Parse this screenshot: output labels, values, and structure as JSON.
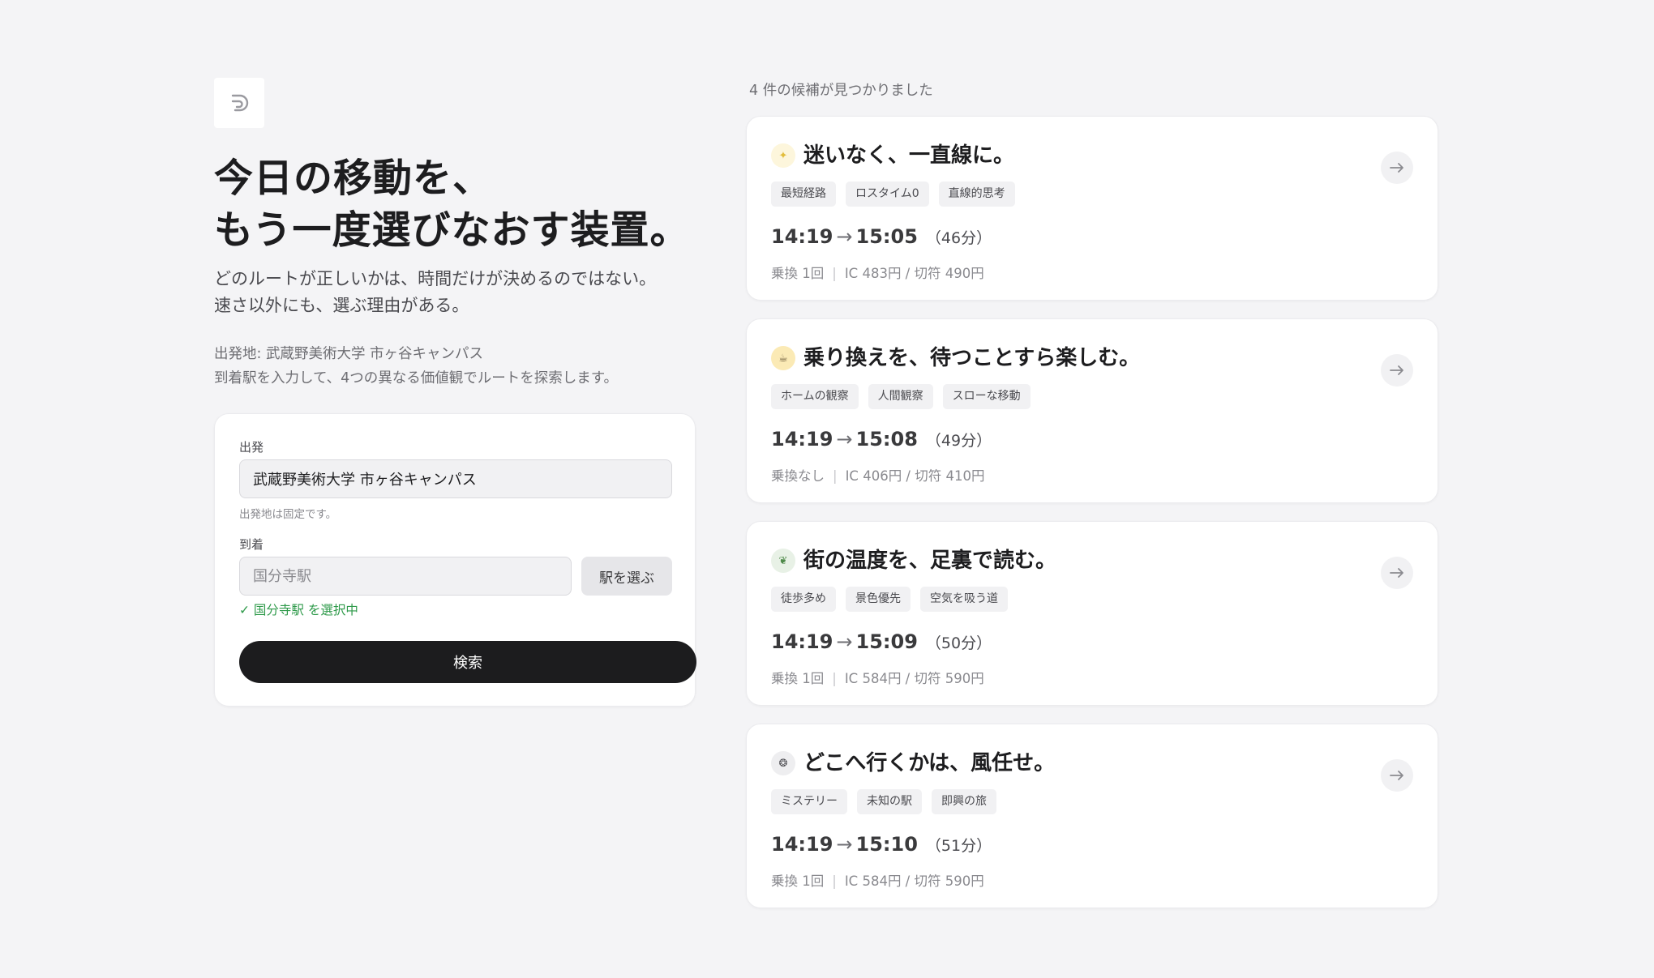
{
  "intro": {
    "headline_line1": "今日の移動を、",
    "headline_line2": "もう一度選びなおす装置。",
    "lead_line1": "どのルートが正しいかは、時間だけが決めるのではない。",
    "lead_line2": "速さ以外にも、選ぶ理由がある。",
    "origin_text": "出発地: 武蔵野美術大学 市ヶ谷キャンパス",
    "instruction": "到着駅を入力して、4つの異なる価値観でルートを探索します。"
  },
  "form": {
    "departure_label": "出発",
    "departure_value": "武蔵野美術大学 市ヶ谷キャンパス",
    "departure_hint": "出発地は固定です。",
    "arrival_label": "到着",
    "arrival_value": "",
    "arrival_placeholder": "国分寺駅",
    "pick_station_label": "駅を選ぶ",
    "selected_text": "✓ 国分寺駅 を選択中",
    "search_label": "検索"
  },
  "results": {
    "count_text": "4 件の候補が見つかりました",
    "routes": [
      {
        "icon": "sparkle-icon",
        "badge_glyph": "✦",
        "badge_color": "#fdf6dc",
        "glyph_color": "#e2bd3c",
        "title": "迷いなく、一直線に。",
        "tags": [
          "最短経路",
          "ロスタイム0",
          "直線的思考"
        ],
        "depart": "14:19",
        "arrow": "→",
        "arrive": "15:05",
        "duration": "（46分）",
        "transfer": "乗換 1回",
        "fare": "IC 483円 / 切符 490円"
      },
      {
        "icon": "coffee-cup-icon",
        "badge_glyph": "☕",
        "badge_color": "#fbeab5",
        "glyph_color": "#6b5a3a",
        "title": "乗り換えを、待つことすら楽しむ。",
        "tags": [
          "ホームの観察",
          "人間観察",
          "スローな移動"
        ],
        "depart": "14:19",
        "arrow": "→",
        "arrive": "15:08",
        "duration": "（49分）",
        "transfer": "乗換なし",
        "fare": "IC 406円 / 切符 410円"
      },
      {
        "icon": "leaf-icon",
        "badge_glyph": "❦",
        "badge_color": "#e8f1e6",
        "glyph_color": "#4f8a4a",
        "title": "街の温度を、足裏で読む。",
        "tags": [
          "徒歩多め",
          "景色優先",
          "空気を吸う道"
        ],
        "depart": "14:19",
        "arrow": "→",
        "arrive": "15:09",
        "duration": "（50分）",
        "transfer": "乗換 1回",
        "fare": "IC 584円 / 切符 590円"
      },
      {
        "icon": "wind-chime-icon",
        "badge_glyph": "❂",
        "badge_color": "#eeeef0",
        "glyph_color": "#4a4a4f",
        "title": "どこへ行くかは、風任せ。",
        "tags": [
          "ミステリー",
          "未知の駅",
          "即興の旅"
        ],
        "depart": "14:19",
        "arrow": "→",
        "arrive": "15:10",
        "duration": "（51分）",
        "transfer": "乗換 1回",
        "fare": "IC 584円 / 切符 590円"
      }
    ]
  }
}
